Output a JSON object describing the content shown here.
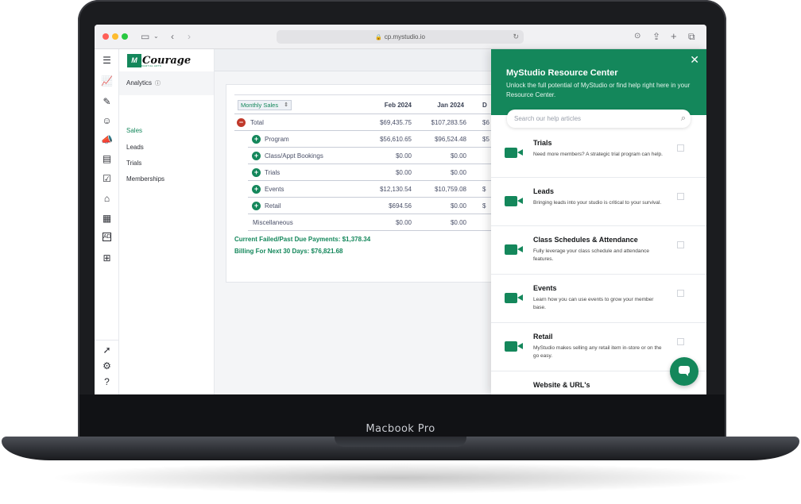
{
  "device": {
    "model_label": "Macbook Pro"
  },
  "browser": {
    "url": "cp.mystudio.io"
  },
  "sidebar": {
    "icons": [
      "sidebar-toggle-icon",
      "analytics-icon",
      "wand-icon",
      "members-icon",
      "megaphone-icon",
      "calendar-settings-icon",
      "clipboard-check-icon",
      "tag-icon",
      "store-icon",
      "ad-icon",
      "apps-icon",
      "rocket-icon",
      "gear-icon",
      "help-icon"
    ]
  },
  "brand": {
    "logo_text": "Courage",
    "logo_mark": "M",
    "logo_sub": "MARTIAL ARTS"
  },
  "subnav": {
    "section": "Analytics",
    "items": [
      {
        "label": "Sales",
        "active": true
      },
      {
        "label": "Leads",
        "active": false
      },
      {
        "label": "Trials",
        "active": false
      },
      {
        "label": "Memberships",
        "active": false
      }
    ]
  },
  "table": {
    "select_label": "Monthly Sales",
    "columns": [
      "Feb 2024",
      "Jan 2024",
      "D"
    ],
    "rows": [
      {
        "label": "Total",
        "icon": "minus",
        "values": [
          "$69,435.75",
          "$107,283.56",
          "$6"
        ]
      },
      {
        "label": "Program",
        "icon": "plus",
        "values": [
          "$56,610.65",
          "$96,524.48",
          "$5"
        ]
      },
      {
        "label": "Class/Appt Bookings",
        "icon": "plus",
        "values": [
          "$0.00",
          "$0.00",
          ""
        ]
      },
      {
        "label": "Trials",
        "icon": "plus",
        "values": [
          "$0.00",
          "$0.00",
          ""
        ]
      },
      {
        "label": "Events",
        "icon": "plus",
        "values": [
          "$12,130.54",
          "$10,759.08",
          "$"
        ]
      },
      {
        "label": "Retail",
        "icon": "plus",
        "values": [
          "$694.56",
          "$0.00",
          "$"
        ]
      },
      {
        "label": "Miscellaneous",
        "icon": "none",
        "values": [
          "$0.00",
          "$0.00",
          ""
        ]
      }
    ],
    "summary": [
      "Current Failed/Past Due Payments: $1,378.34",
      "Billing For Next 30 Days: $76,821.68"
    ]
  },
  "resource_center": {
    "title": "MyStudio Resource Center",
    "subtitle": "Unlock the full potential of MyStudio or find help right here in your Resource Center.",
    "search_placeholder": "Search our help articles",
    "items": [
      {
        "title": "Trials",
        "desc": "Need more members? A strategic trial program can help."
      },
      {
        "title": "Leads",
        "desc": "Bringing leads into your studio is critical to your survival."
      },
      {
        "title": "Class Schedules & Attendance",
        "desc": "Fully leverage your class schedule and attendance features."
      },
      {
        "title": "Events",
        "desc": "Learn how you can use events to grow your member base."
      },
      {
        "title": "Retail",
        "desc": "MyStudio makes selling any retail item in-store or on the go easy."
      },
      {
        "title": "Website & URL's",
        "desc": ""
      }
    ]
  },
  "colors": {
    "accent": "#14875b",
    "danger": "#c0392b",
    "text": "#4a5068"
  }
}
